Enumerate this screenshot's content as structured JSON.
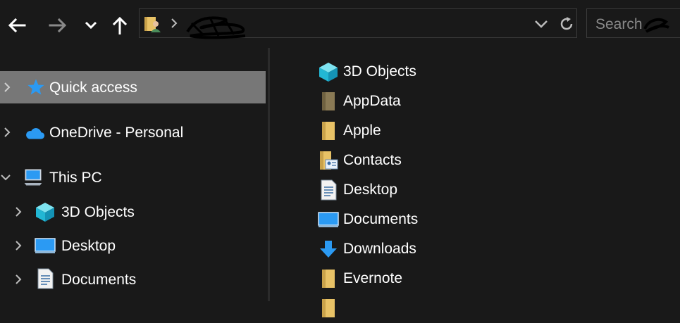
{
  "toolbar": {
    "back_icon": "back-arrow-icon",
    "forward_icon": "forward-arrow-icon",
    "recent_icon": "chevron-down-icon",
    "up_icon": "up-arrow-icon"
  },
  "address": {
    "location_icon": "user-folder-icon",
    "dropdown_icon": "chevron-down-icon",
    "refresh_icon": "refresh-icon"
  },
  "search": {
    "placeholder": "Search"
  },
  "nav": {
    "quick_access": "Quick access",
    "onedrive": "OneDrive - Personal",
    "this_pc": "This PC",
    "items": [
      "3D Objects",
      "Desktop",
      "Documents"
    ]
  },
  "files": [
    {
      "name": "3D Objects",
      "icon": "cube-icon"
    },
    {
      "name": "AppData",
      "icon": "hidden-folder-icon"
    },
    {
      "name": "Apple",
      "icon": "folder-icon"
    },
    {
      "name": "Contacts",
      "icon": "contacts-folder-icon"
    },
    {
      "name": "Desktop",
      "icon": "document-icon"
    },
    {
      "name": "Documents",
      "icon": "monitor-icon"
    },
    {
      "name": "Downloads",
      "icon": "download-icon"
    },
    {
      "name": "Evernote",
      "icon": "folder-icon"
    }
  ],
  "colors": {
    "background": "#191919",
    "selected": "#777777",
    "folder_yellow": "#e8c266",
    "accent_blue": "#2b9af3"
  }
}
